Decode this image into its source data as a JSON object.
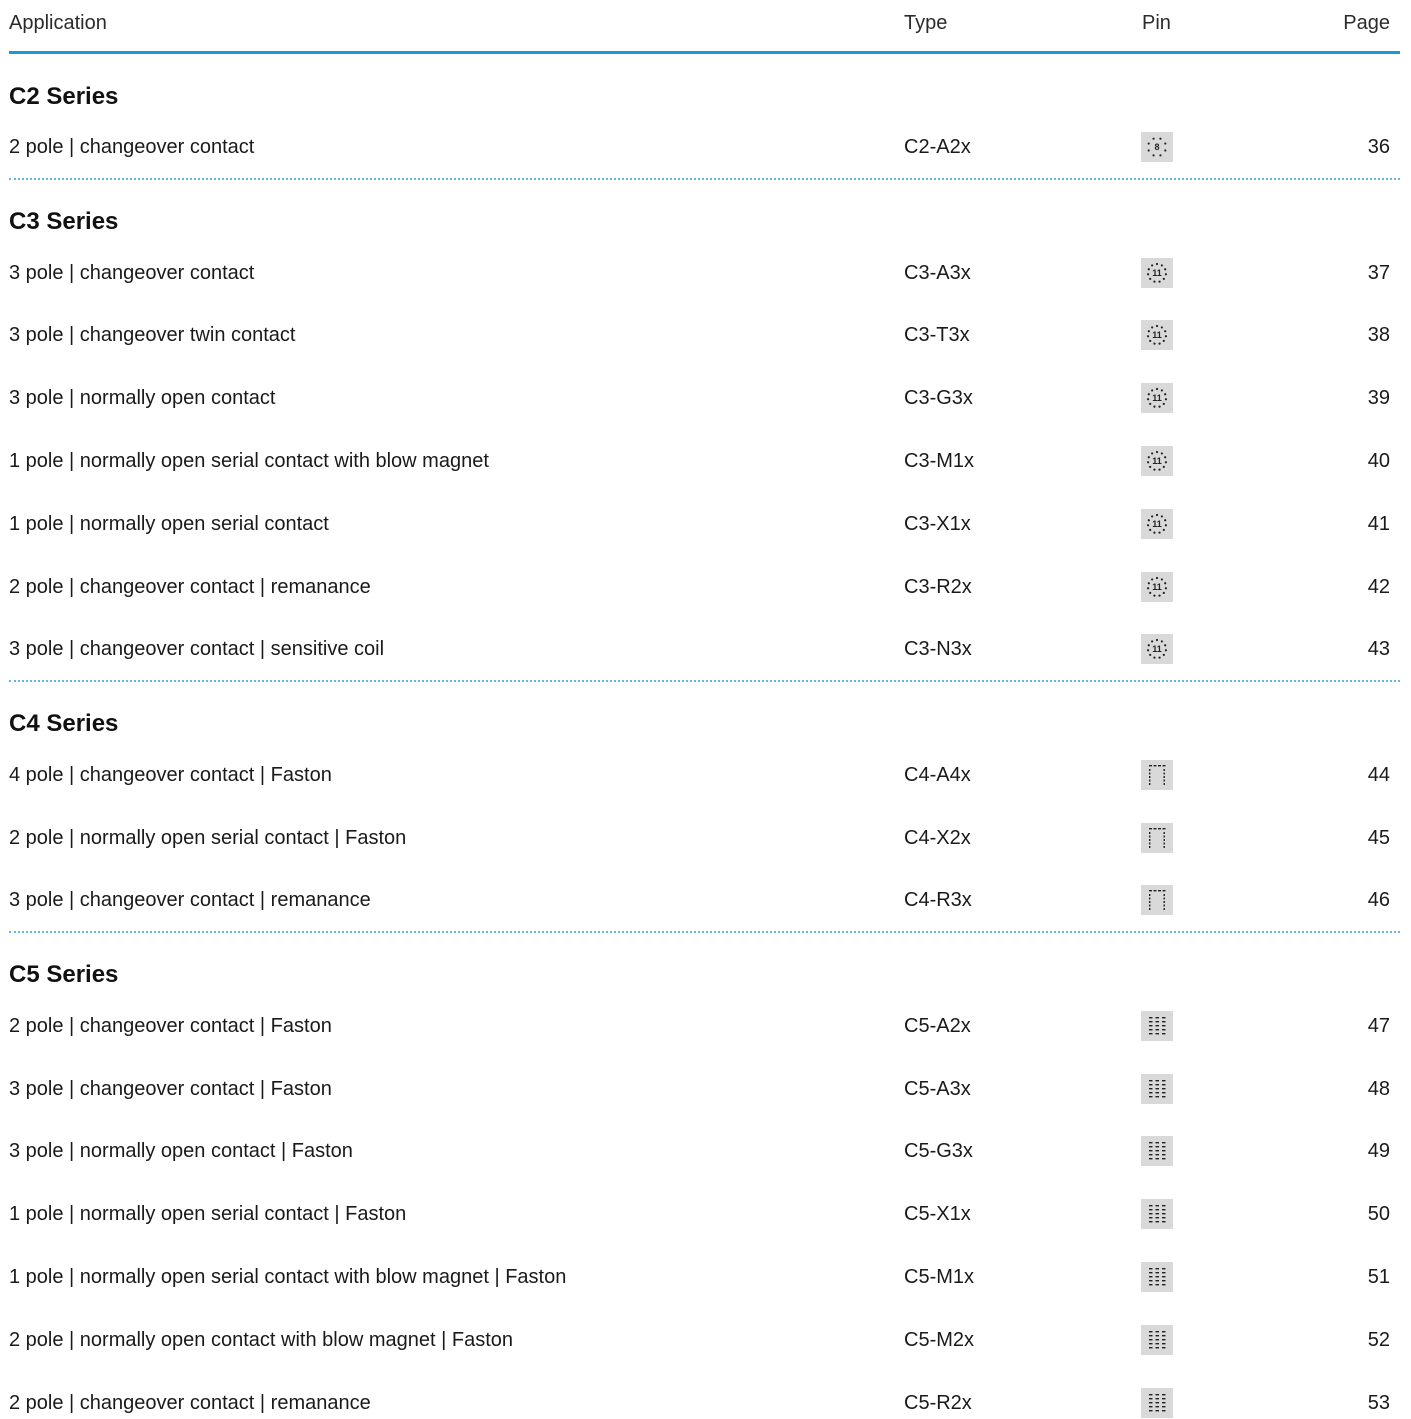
{
  "header": {
    "application": "Application",
    "type": "Type",
    "pin": "Pin",
    "page": "Page"
  },
  "series": [
    {
      "title": "C2 Series",
      "rows": [
        {
          "application": "2 pole | changeover contact",
          "type": "C2-A2x",
          "pin_icon": "pin-8-round-icon",
          "page": "36"
        }
      ]
    },
    {
      "title": "C3 Series",
      "rows": [
        {
          "application": "3 pole | changeover contact",
          "type": "C3-A3x",
          "pin_icon": "pin-11-round-icon",
          "page": "37"
        },
        {
          "application": "3 pole | changeover twin contact",
          "type": "C3-T3x",
          "pin_icon": "pin-11-round-icon",
          "page": "38"
        },
        {
          "application": "3 pole | normally open contact",
          "type": "C3-G3x",
          "pin_icon": "pin-11-round-icon",
          "page": "39"
        },
        {
          "application": "1 pole | normally open serial contact with blow magnet",
          "type": "C3-M1x",
          "pin_icon": "pin-11-round-icon",
          "page": "40"
        },
        {
          "application": "1 pole | normally open serial contact",
          "type": "C3-X1x",
          "pin_icon": "pin-11-round-icon",
          "page": "41"
        },
        {
          "application": "2 pole | changeover contact | remanance",
          "type": "C3-R2x",
          "pin_icon": "pin-11-round-icon",
          "page": "42"
        },
        {
          "application": "3 pole | changeover contact | sensitive coil",
          "type": "C3-N3x",
          "pin_icon": "pin-11-round-icon",
          "page": "43"
        }
      ]
    },
    {
      "title": "C4 Series",
      "rows": [
        {
          "application": "4 pole | changeover contact | Faston",
          "type": "C4-A4x",
          "pin_icon": "pin-grid-c4-icon",
          "page": "44"
        },
        {
          "application": "2 pole | normally open serial contact | Faston",
          "type": "C4-X2x",
          "pin_icon": "pin-grid-c4-icon",
          "page": "45"
        },
        {
          "application": "3 pole | changeover contact | remanance",
          "type": "C4-R3x",
          "pin_icon": "pin-grid-c4-icon",
          "page": "46"
        }
      ]
    },
    {
      "title": "C5 Series",
      "rows": [
        {
          "application": "2 pole | changeover contact | Faston",
          "type": "C5-A2x",
          "pin_icon": "pin-grid-c5-icon",
          "page": "47"
        },
        {
          "application": "3 pole | changeover contact | Faston",
          "type": "C5-A3x",
          "pin_icon": "pin-grid-c5-icon",
          "page": "48"
        },
        {
          "application": "3 pole | normally open contact | Faston",
          "type": "C5-G3x",
          "pin_icon": "pin-grid-c5-icon",
          "page": "49"
        },
        {
          "application": "1 pole | normally open serial contact | Faston",
          "type": "C5-X1x",
          "pin_icon": "pin-grid-c5-icon",
          "page": "50"
        },
        {
          "application": "1 pole | normally open serial contact with blow magnet | Faston",
          "type": "C5-M1x",
          "pin_icon": "pin-grid-c5-icon",
          "page": "51"
        },
        {
          "application": "2 pole | normally open contact with blow magnet | Faston",
          "type": "C5-M2x",
          "pin_icon": "pin-grid-c5-icon",
          "page": "52"
        },
        {
          "application": "2 pole | changeover contact | remanance",
          "type": "C5-R2x",
          "pin_icon": "pin-grid-c5-icon",
          "page": "53"
        }
      ]
    }
  ],
  "pin_labels": {
    "round_8": "8",
    "round_11": "11"
  },
  "colors": {
    "accent": "#1b98d5",
    "divider": "#5fb8e0",
    "pin_background": "#d9d9d9"
  }
}
